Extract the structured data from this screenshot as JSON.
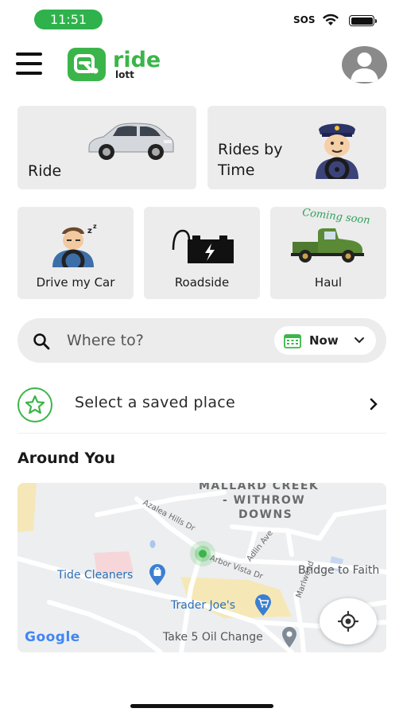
{
  "status_bar": {
    "time": "11:51",
    "sos": "SOS"
  },
  "header": {
    "logo_ride": "ride",
    "logo_lott": "lott"
  },
  "tiles": {
    "ride": "Ride",
    "rides_by_time_line1": "Rides by",
    "rides_by_time_line2": "Time",
    "drive_my_car": "Drive my Car",
    "roadside": "Roadside",
    "haul": "Haul",
    "haul_badge": "Coming soon"
  },
  "search": {
    "placeholder": "Where to?",
    "when": "Now"
  },
  "saved_place": {
    "label": "Select a saved place"
  },
  "around_you": {
    "title": "Around You"
  },
  "map": {
    "neighborhood_line1": "MALLARD CREEK",
    "neighborhood_line2": "- WITHROW",
    "neighborhood_line3": "DOWNS",
    "streets": [
      "Azalea Hills Dr",
      "Adlin Ave",
      "Arbor Vista Dr",
      "Marlwood"
    ],
    "pois": {
      "tide_cleaners": "Tide Cleaners",
      "bridge_to_faith": "Bridge to Faith",
      "trader_joes": "Trader Joe's",
      "take5": "Take 5 Oil Change"
    },
    "attribution": "Google"
  },
  "colors": {
    "brand_green": "#3bb54a",
    "tile_bg": "#ececec",
    "status_pill": "#2fb24c"
  }
}
